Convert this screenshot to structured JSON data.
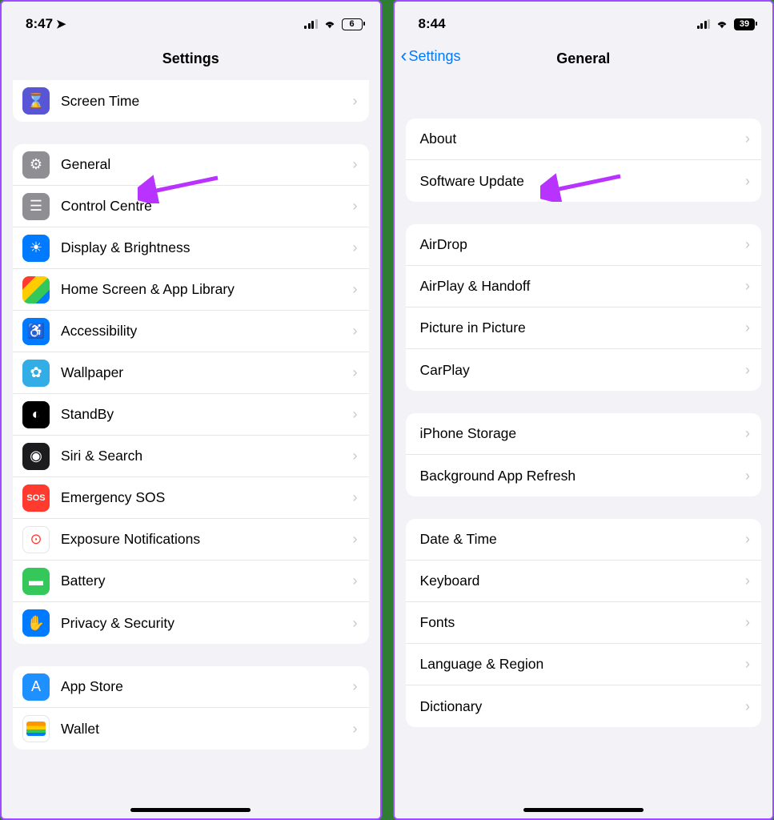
{
  "left": {
    "status": {
      "time": "8:47",
      "battery": "6"
    },
    "title": "Settings",
    "group0": [
      {
        "label": "Screen Time",
        "icon": "screen-time-icon",
        "color": "ic-purple",
        "glyph": "⌛"
      }
    ],
    "group1": [
      {
        "label": "General",
        "icon": "general-icon",
        "color": "ic-gray",
        "glyph": "⚙"
      },
      {
        "label": "Control Centre",
        "icon": "control-centre-icon",
        "color": "ic-darkgray",
        "glyph": "☰"
      },
      {
        "label": "Display & Brightness",
        "icon": "display-icon",
        "color": "ic-blue",
        "glyph": "☀"
      },
      {
        "label": "Home Screen & App Library",
        "icon": "home-screen-icon",
        "color": "ic-multi",
        "glyph": ""
      },
      {
        "label": "Accessibility",
        "icon": "accessibility-icon",
        "color": "ic-blue",
        "glyph": "♿"
      },
      {
        "label": "Wallpaper",
        "icon": "wallpaper-icon",
        "color": "ic-cyan",
        "glyph": "✿"
      },
      {
        "label": "StandBy",
        "icon": "standby-icon",
        "color": "ic-black",
        "glyph": "◐"
      },
      {
        "label": "Siri & Search",
        "icon": "siri-icon",
        "color": "ic-dark",
        "glyph": "◉"
      },
      {
        "label": "Emergency SOS",
        "icon": "sos-icon",
        "color": "ic-red",
        "glyph": "SOS"
      },
      {
        "label": "Exposure Notifications",
        "icon": "exposure-icon",
        "color": "ic-white",
        "glyph": "⊙"
      },
      {
        "label": "Battery",
        "icon": "battery-icon",
        "color": "ic-green",
        "glyph": "▬"
      },
      {
        "label": "Privacy & Security",
        "icon": "privacy-icon",
        "color": "ic-blue2",
        "glyph": "✋"
      }
    ],
    "group2": [
      {
        "label": "App Store",
        "icon": "app-store-icon",
        "color": "ic-appstore",
        "glyph": "A"
      },
      {
        "label": "Wallet",
        "icon": "wallet-icon",
        "color": "ic-wallet",
        "glyph": ""
      }
    ]
  },
  "right": {
    "status": {
      "time": "8:44",
      "battery": "39"
    },
    "back": "Settings",
    "title": "General",
    "group0": [
      {
        "label": "About"
      },
      {
        "label": "Software Update"
      }
    ],
    "group1": [
      {
        "label": "AirDrop"
      },
      {
        "label": "AirPlay & Handoff"
      },
      {
        "label": "Picture in Picture"
      },
      {
        "label": "CarPlay"
      }
    ],
    "group2": [
      {
        "label": "iPhone Storage"
      },
      {
        "label": "Background App Refresh"
      }
    ],
    "group3": [
      {
        "label": "Date & Time"
      },
      {
        "label": "Keyboard"
      },
      {
        "label": "Fonts"
      },
      {
        "label": "Language & Region"
      },
      {
        "label": "Dictionary"
      }
    ]
  }
}
